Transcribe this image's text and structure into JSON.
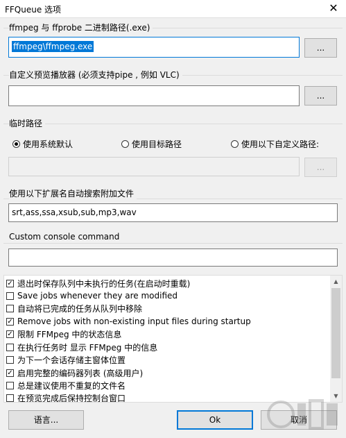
{
  "window": {
    "title": "FFQueue 选项",
    "close_label": "✕"
  },
  "ffmpeg": {
    "label": "ffmpeg 与 ffprobe 二进制路径(.exe)",
    "value": "ffmpeg\\ffmpeg.exe",
    "browse_label": "..."
  },
  "player": {
    "label": "自定义预览播放器 (必须支持pipe , 例如 VLC)",
    "value": "",
    "browse_label": "..."
  },
  "temp": {
    "label": "临时路径",
    "options": [
      {
        "label": "使用系统默认",
        "selected": true
      },
      {
        "label": "使用目标路径",
        "selected": false
      },
      {
        "label": "使用以下自定义路径:",
        "selected": false
      }
    ],
    "value": "",
    "browse_label": "..."
  },
  "extensions": {
    "label": "使用以下扩展名自动搜索附加文件",
    "value": "srt,ass,ssa,xsub,sub,mp3,wav"
  },
  "console": {
    "label": "Custom console command",
    "value": ""
  },
  "checklist": [
    {
      "label": "退出时保存队列中未执行的任务(在启动时重载)",
      "checked": true
    },
    {
      "label": "Save jobs whenever they are modified",
      "checked": false
    },
    {
      "label": "自动将已完成的任务从队列中移除",
      "checked": false
    },
    {
      "label": "Remove jobs with non-existing input files during startup",
      "checked": true
    },
    {
      "label": "限制 FFMpeg 中的状态信息",
      "checked": true
    },
    {
      "label": "在执行任务时 显示 FFMpeg 中的信息",
      "checked": false
    },
    {
      "label": "为下一个会话存储主窗体位置",
      "checked": false
    },
    {
      "label": "启用完整的编码器列表 (高级用户)",
      "checked": true
    },
    {
      "label": "总是建议使用不重复的文件名",
      "checked": false
    },
    {
      "label": "在预览完成后保持控制台窗口",
      "checked": false
    }
  ],
  "buttons": {
    "language": "语言...",
    "ok": "Ok",
    "cancel": "取消"
  },
  "colors": {
    "accent": "#0078d7"
  }
}
